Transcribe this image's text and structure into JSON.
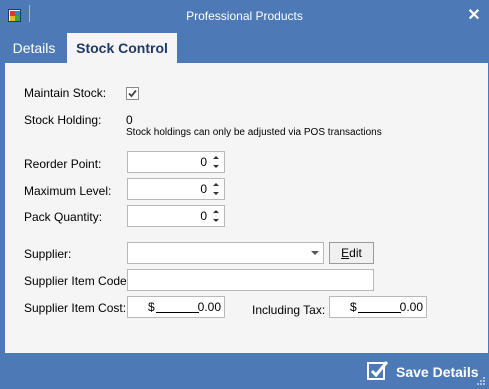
{
  "window": {
    "title": "Professional Products",
    "close_glyph": "✕"
  },
  "tabs": [
    {
      "label": "Details",
      "selected": false
    },
    {
      "label": "Stock Control",
      "selected": true
    }
  ],
  "form": {
    "maintain_stock": {
      "label": "Maintain Stock:",
      "checked": true
    },
    "stock_holding": {
      "label": "Stock Holding:",
      "value": "0",
      "note": "Stock holdings can only be adjusted via POS transactions"
    },
    "reorder_point": {
      "label": "Reorder Point:",
      "value": "0"
    },
    "maximum_level": {
      "label": "Maximum Level:",
      "value": "0"
    },
    "pack_quantity": {
      "label": "Pack Quantity:",
      "value": "0"
    },
    "supplier": {
      "label": "Supplier:",
      "value": "",
      "edit_label": "Edit",
      "edit_underlined_char": "E",
      "edit_rest": "dit"
    },
    "supplier_item_code": {
      "label": "Supplier Item Code:",
      "value": ""
    },
    "supplier_item_cost": {
      "label": "Supplier Item Cost:",
      "currency": "$",
      "value": "0.00"
    },
    "including_tax": {
      "label": "Including Tax:",
      "currency": "$",
      "value": "0.00"
    }
  },
  "footer": {
    "save_label": "Save Details"
  },
  "colors": {
    "chrome": "#4d7ab6",
    "panel": "#f5f5f5",
    "active_tab_text": "#1f3a66"
  },
  "icons": {
    "app": "app-icon",
    "close": "close-icon",
    "save": "check-icon"
  }
}
